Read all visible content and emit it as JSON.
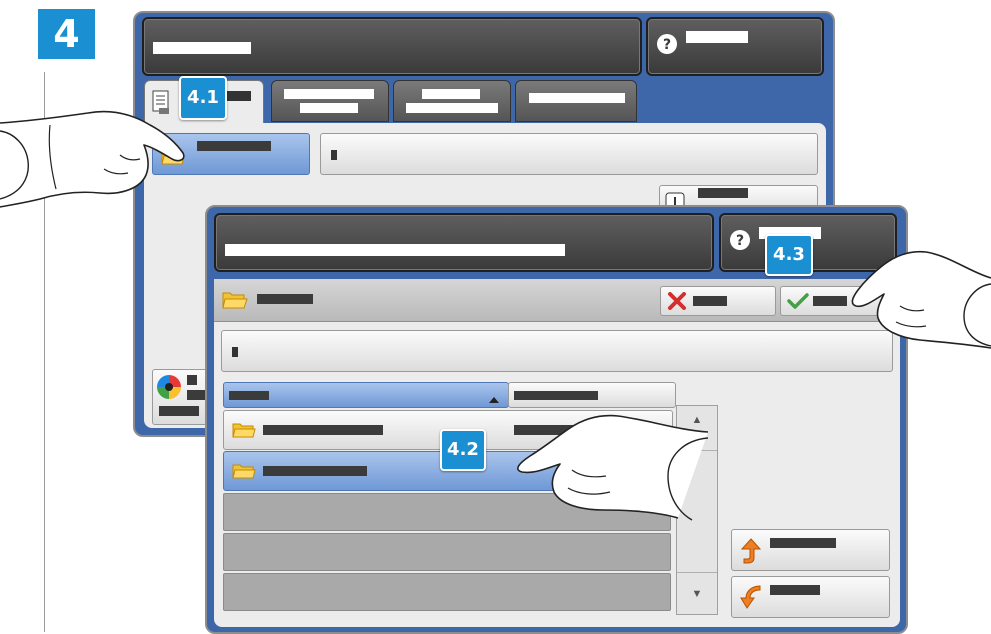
{
  "step": {
    "number": "4"
  },
  "callouts": {
    "c41": "4.1",
    "c42": "4.2",
    "c43": "4.3"
  },
  "scroll": {
    "up_glyph": "▲",
    "down_glyph": "▼"
  },
  "colors": {
    "accent": "#1a8fd2",
    "screen_bg": "#3e67a9",
    "selected_row": "#7ea3dc"
  },
  "icons": [
    "help-icon",
    "document-icon",
    "folder-icon",
    "cancel-icon",
    "ok-icon",
    "color-wheel-icon",
    "sort-ascending-icon",
    "move-up-icon",
    "move-back-icon"
  ]
}
